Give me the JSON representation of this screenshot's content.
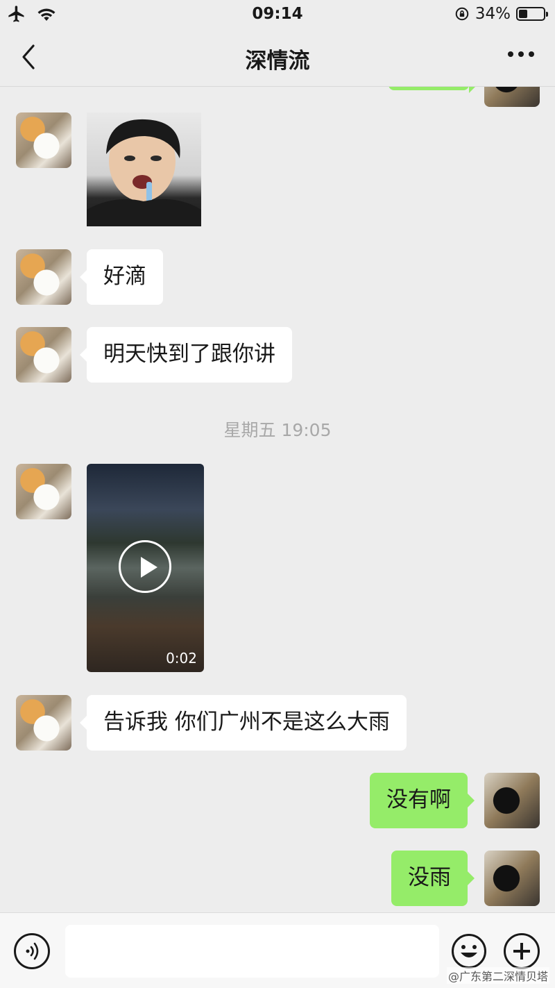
{
  "status_bar": {
    "time": "09:14",
    "battery_text": "34%",
    "battery_level": 0.34
  },
  "nav": {
    "title": "深情流"
  },
  "messages": [
    {
      "side": "in",
      "type": "sticker",
      "description": "sticker-photo"
    },
    {
      "side": "in",
      "type": "text",
      "text": "好滴"
    },
    {
      "side": "in",
      "type": "text",
      "text": "明天快到了跟你讲"
    },
    {
      "type": "timestamp",
      "text": "星期五 19:05"
    },
    {
      "side": "in",
      "type": "video",
      "duration": "0:02"
    },
    {
      "side": "in",
      "type": "text",
      "text": "告诉我 你们广州不是这么大雨"
    },
    {
      "side": "out",
      "type": "text",
      "text": "没有啊"
    },
    {
      "side": "out",
      "type": "text",
      "text": "没雨"
    }
  ],
  "input_bar": {
    "placeholder": ""
  },
  "watermark": "@广东第二深情贝塔",
  "colors": {
    "background": "#ededed",
    "bubble_out": "#95ec69",
    "bubble_in": "#ffffff"
  }
}
